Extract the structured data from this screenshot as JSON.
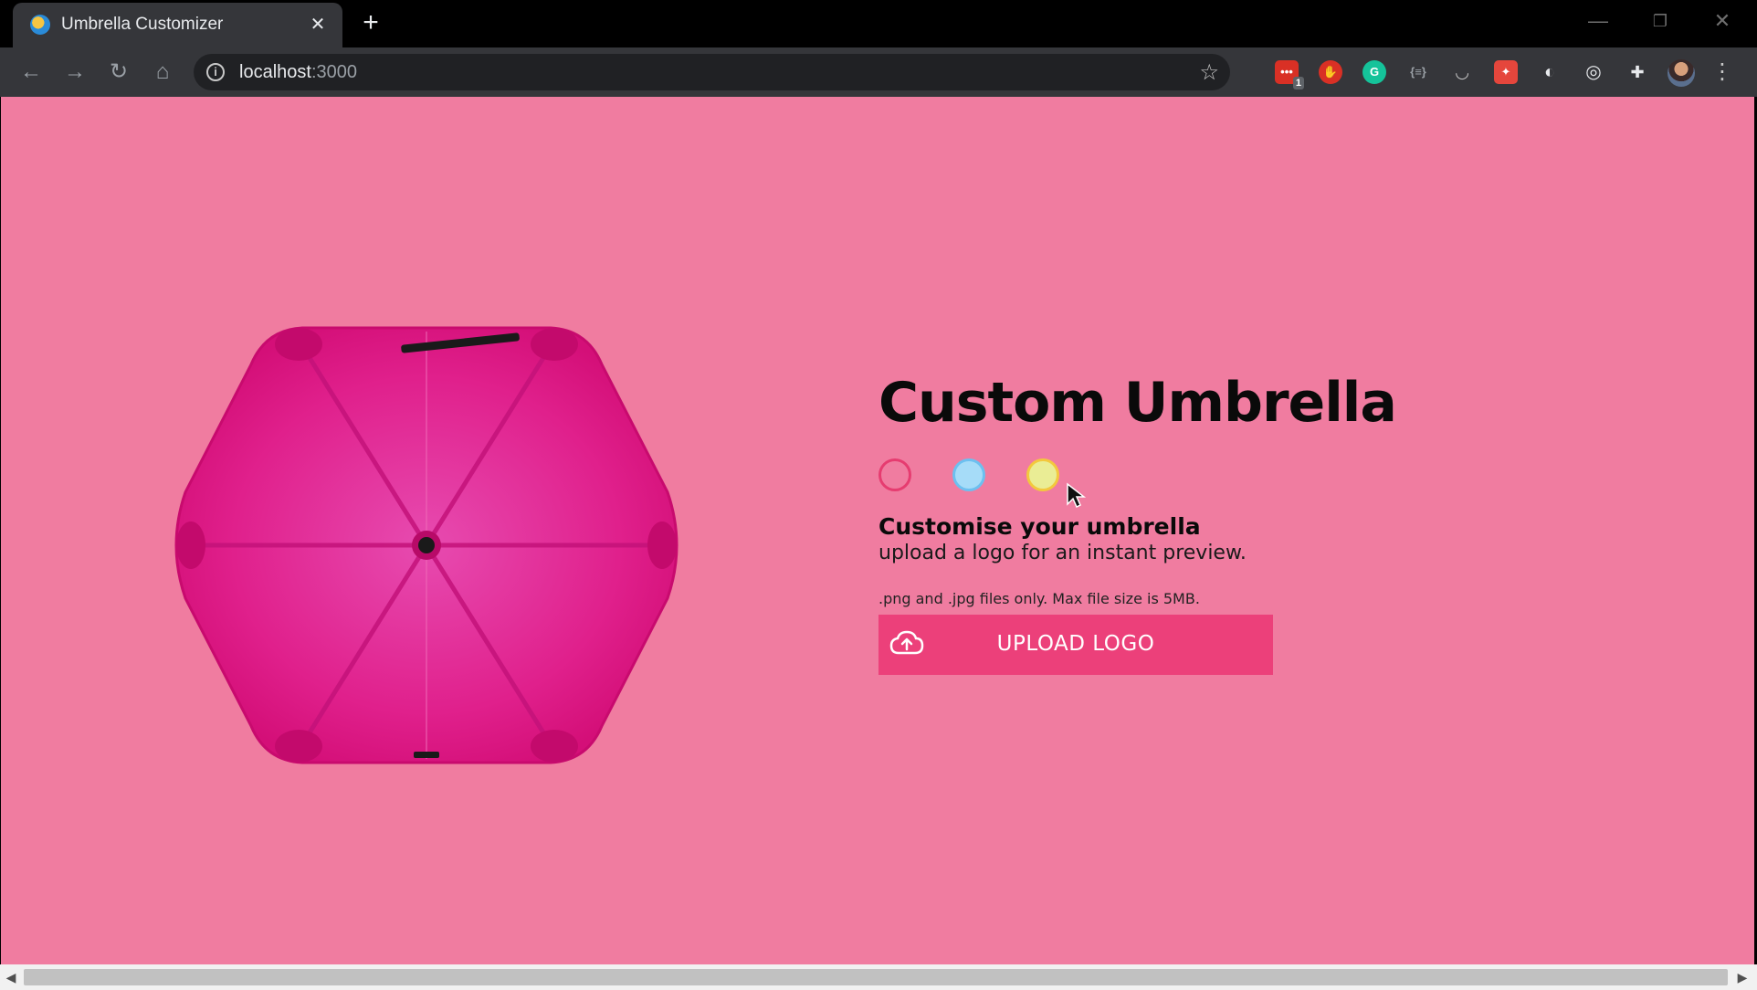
{
  "browser": {
    "tab_title": "Umbrella Customizer",
    "tab_close": "✕",
    "new_tab": "+",
    "url_host": "localhost",
    "url_port": ":3000",
    "extension_badge": "1",
    "window_controls": {
      "minimize": "—",
      "restore": "❐",
      "close": "✕"
    }
  },
  "page": {
    "background_color": "#f07ca0",
    "headline": "Custom Umbrella",
    "swatches": [
      {
        "name": "pink",
        "color": "#e63c70",
        "selected": true
      },
      {
        "name": "blue",
        "color": "#a6dcf8",
        "selected": false
      },
      {
        "name": "yellow",
        "color": "#eaed95",
        "selected": false
      }
    ],
    "subtitle": "Customise your umbrella",
    "description": "upload a logo for an instant preview.",
    "hint": ".png and .jpg files only. Max file size is 5MB.",
    "upload_button_label": "UPLOAD LOGO",
    "umbrella_color": "#e0157c",
    "icons": {
      "upload": "cloud-upload-icon",
      "umbrella": "umbrella-image"
    }
  }
}
